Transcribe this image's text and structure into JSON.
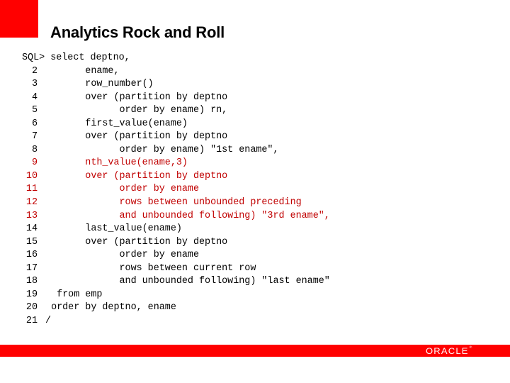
{
  "slide": {
    "title": "Analytics Rock and Roll",
    "accent_color": "#ff0000",
    "highlight_color": "#c00000"
  },
  "code": {
    "prompt": "SQL>",
    "lines": [
      {
        "n": "SQL>",
        "text": " select deptno,",
        "highlight": false
      },
      {
        "n": "2",
        "text": "        ename,",
        "highlight": false
      },
      {
        "n": "3",
        "text": "        row_number()",
        "highlight": false
      },
      {
        "n": "4",
        "text": "        over (partition by deptno",
        "highlight": false
      },
      {
        "n": "5",
        "text": "              order by ename) rn,",
        "highlight": false
      },
      {
        "n": "6",
        "text": "        first_value(ename)",
        "highlight": false
      },
      {
        "n": "7",
        "text": "        over (partition by deptno",
        "highlight": false
      },
      {
        "n": "8",
        "text": "              order by ename) \"1st ename\",",
        "highlight": false
      },
      {
        "n": "9",
        "text": "        nth_value(ename,3)",
        "highlight": true
      },
      {
        "n": "10",
        "text": "        over (partition by deptno",
        "highlight": true
      },
      {
        "n": "11",
        "text": "              order by ename",
        "highlight": true
      },
      {
        "n": "12",
        "text": "              rows between unbounded preceding",
        "highlight": true
      },
      {
        "n": "13",
        "text": "              and unbounded following) \"3rd ename\",",
        "highlight": true
      },
      {
        "n": "14",
        "text": "        last_value(ename)",
        "highlight": false
      },
      {
        "n": "15",
        "text": "        over (partition by deptno",
        "highlight": false
      },
      {
        "n": "16",
        "text": "              order by ename",
        "highlight": false
      },
      {
        "n": "17",
        "text": "              rows between current row",
        "highlight": false
      },
      {
        "n": "18",
        "text": "              and unbounded following) \"last ename\"",
        "highlight": false
      },
      {
        "n": "19",
        "text": "   from emp",
        "highlight": false
      },
      {
        "n": "20",
        "text": "  order by deptno, ename",
        "highlight": false
      },
      {
        "n": "21",
        "text": " /",
        "highlight": false
      }
    ]
  },
  "footer": {
    "logo_text": "ORACLE",
    "logo_mark": "®"
  }
}
